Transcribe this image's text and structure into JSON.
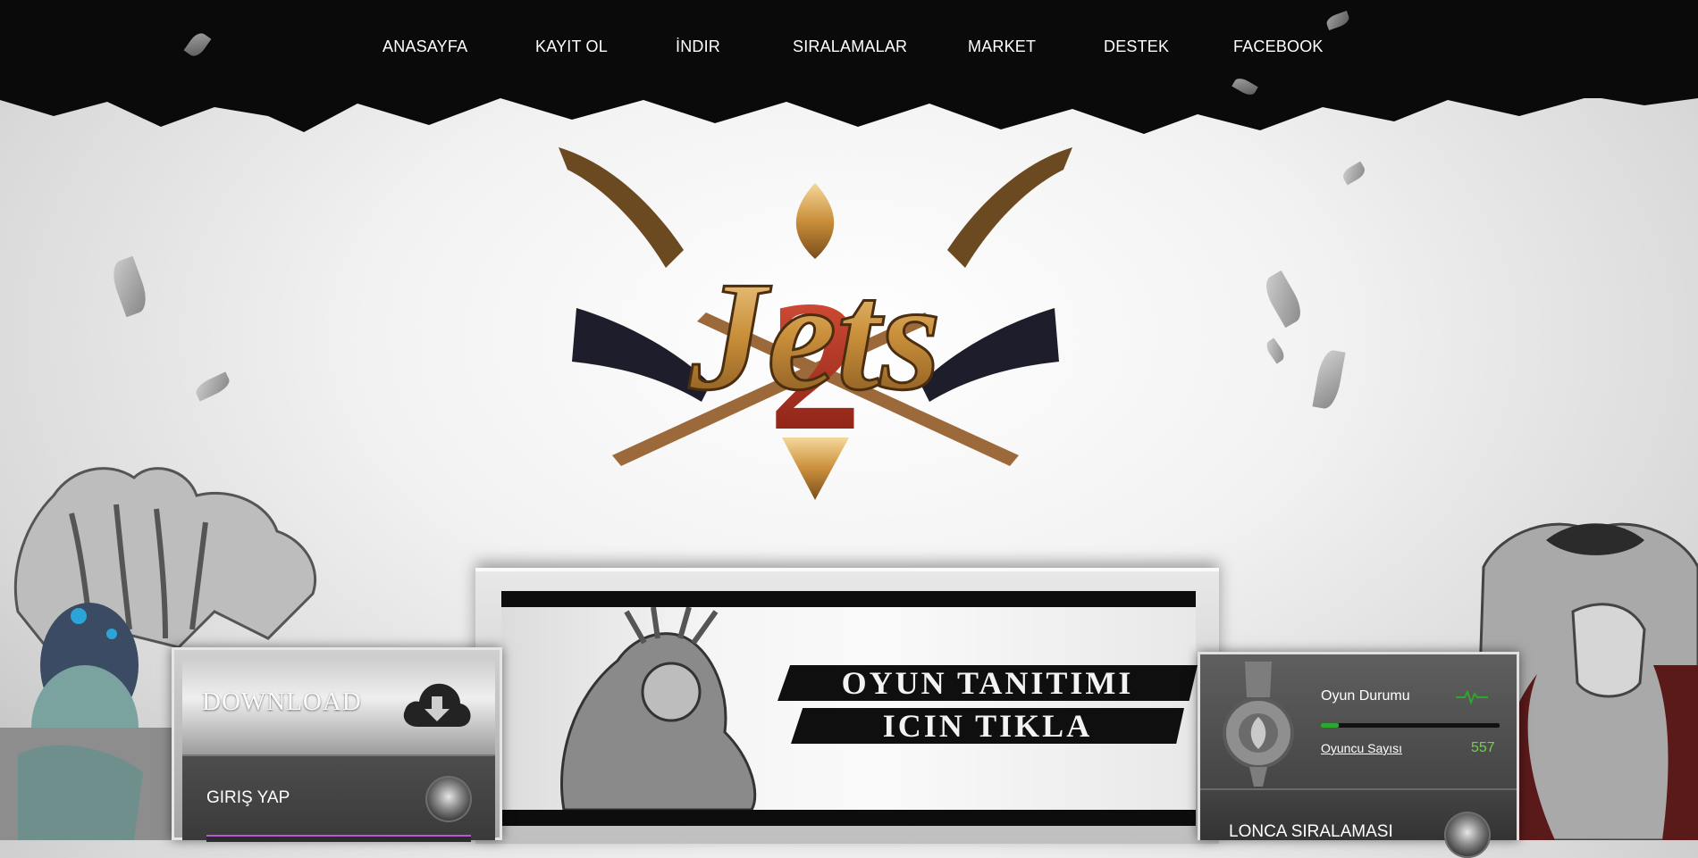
{
  "nav": {
    "items": [
      {
        "label": "ANASAYFA"
      },
      {
        "label": "KAYIT OL"
      },
      {
        "label": "İNDIR"
      },
      {
        "label": "SIRALAMALAR"
      },
      {
        "label": "MARKET"
      },
      {
        "label": "DESTEK"
      },
      {
        "label": "FACEBOOK"
      }
    ]
  },
  "logo": {
    "text": "Jets 2"
  },
  "banner": {
    "line1": "OYUN TANITIMI",
    "line2": "ICIN TIKLA"
  },
  "left_panel": {
    "download_label": "DOWNLOAD",
    "login_label": "GIRIŞ YAP"
  },
  "right_panel": {
    "status_title": "Oyun Durumu",
    "status_level": 0.1,
    "player_label": "Oyuncu Sayısı",
    "player_count": "557",
    "guild_label": "LONCA SIRALAMASI"
  },
  "colors": {
    "online_green": "#2da62d",
    "count_green": "#6ed24a",
    "input_accent": "#b45ad3",
    "ink": "#0a0a0a"
  }
}
